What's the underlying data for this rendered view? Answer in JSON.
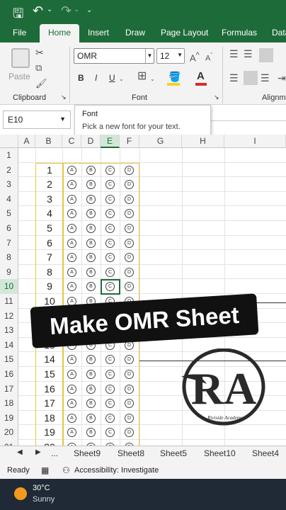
{
  "titlebar": {
    "save_icon": "save-icon",
    "undo_icon": "undo-icon",
    "redo_icon": "redo-icon"
  },
  "tabs": [
    "File",
    "Home",
    "Insert",
    "Draw",
    "Page Layout",
    "Formulas",
    "Data"
  ],
  "ribbon": {
    "paste_label": "Paste",
    "font_name": "OMR",
    "font_size": "12",
    "bold": "B",
    "italic": "I",
    "underline": "U",
    "groups": {
      "clipboard": "Clipboard",
      "font": "Font",
      "alignment": "Alignm"
    },
    "accent_colors": {
      "fill": "#f5d327",
      "font": "#d32f2f"
    }
  },
  "tooltip": {
    "title": "Font",
    "desc": "Pick a new font for your text."
  },
  "namebox": "E10",
  "columns": [
    "A",
    "B",
    "C",
    "D",
    "E",
    "F",
    "G",
    "H",
    "I"
  ],
  "rows": [
    "1",
    "2",
    "3",
    "4",
    "5",
    "6",
    "7",
    "8",
    "9",
    "10",
    "11",
    "12",
    "13",
    "14",
    "15",
    "16",
    "17",
    "18",
    "19",
    "20",
    "21"
  ],
  "question_numbers": [
    "1",
    "2",
    "3",
    "4",
    "5",
    "6",
    "7",
    "8",
    "9",
    "10",
    "11",
    "12",
    "13",
    "14",
    "15",
    "16",
    "17",
    "18",
    "19",
    "20"
  ],
  "options": [
    "A",
    "B",
    "C",
    "D"
  ],
  "banner": "Make OMR Sheet",
  "logo": {
    "initials": "RA",
    "caption": "Riviside Academy"
  },
  "sheet_tabs": [
    "...",
    "Sheet9",
    "Sheet8",
    "Sheet5",
    "Sheet10",
    "Sheet4"
  ],
  "status": {
    "ready": "Ready",
    "accessibility": "Accessibility: Investigate"
  },
  "taskbar": {
    "temp": "30°C",
    "weather": "Sunny"
  }
}
